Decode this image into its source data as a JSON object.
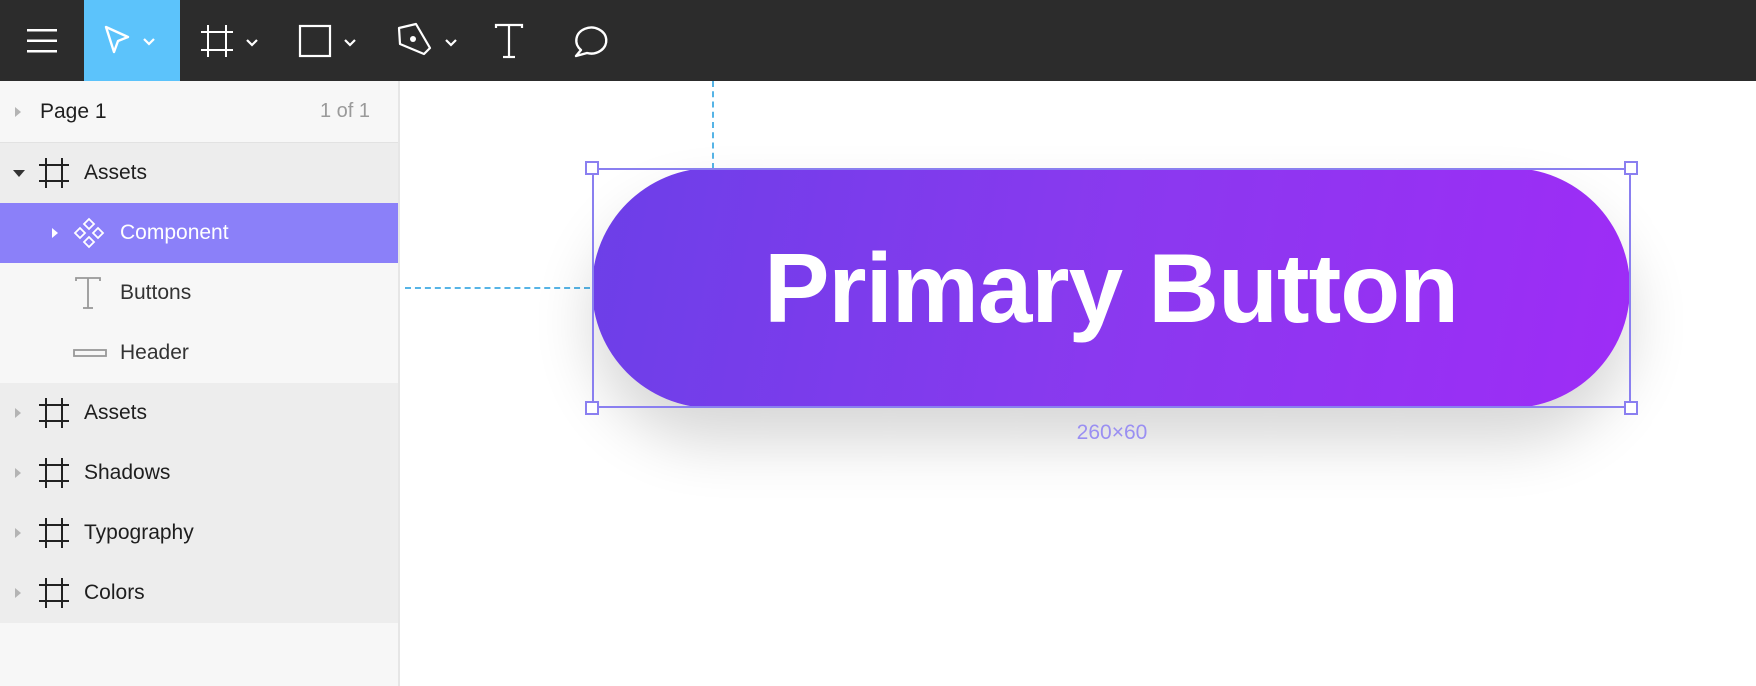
{
  "toolbar": {
    "tools": [
      {
        "name": "menu-icon"
      },
      {
        "name": "move-tool-icon",
        "active": true
      },
      {
        "name": "frame-tool-icon"
      },
      {
        "name": "rectangle-tool-icon"
      },
      {
        "name": "pen-tool-icon"
      },
      {
        "name": "text-tool-icon"
      },
      {
        "name": "comment-tool-icon"
      }
    ],
    "colors": {
      "background": "#2c2c2c",
      "active": "#5cc3fb"
    }
  },
  "layers": {
    "page": {
      "label": "Page 1",
      "count": "1 of 1"
    },
    "items": [
      {
        "label": "Assets",
        "icon": "frame-icon",
        "expanded": true
      },
      {
        "label": "Component",
        "icon": "component-icon",
        "selected": true
      },
      {
        "label": "Buttons",
        "icon": "text-layer-icon"
      },
      {
        "label": "Header",
        "icon": "rectangle-layer-icon"
      },
      {
        "label": "Assets",
        "icon": "frame-icon"
      },
      {
        "label": "Shadows",
        "icon": "frame-icon"
      },
      {
        "label": "Typography",
        "icon": "frame-icon"
      },
      {
        "label": "Colors",
        "icon": "frame-icon"
      }
    ],
    "colors": {
      "selected": "#8b80f9"
    }
  },
  "canvas": {
    "button_label": "Primary Button",
    "dimensions": "260×60",
    "colors": {
      "gradient_start": "#6c3fe8",
      "gradient_end": "#9e2cf6",
      "selection": "#8a7ff0",
      "guide": "#56b4e6"
    }
  }
}
